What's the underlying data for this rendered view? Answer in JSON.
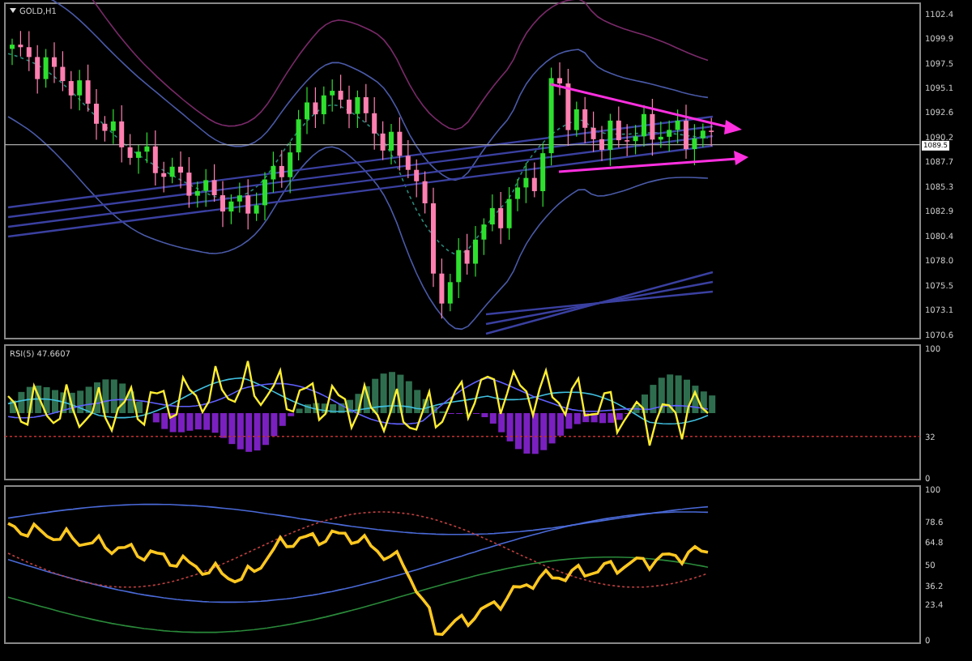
{
  "main_chart": {
    "symbol": "GOLD,H1",
    "price_axis": [
      "1102.4",
      "1099.9",
      "1097.5",
      "1095.1",
      "1092.6",
      "1090.2",
      "1087.7",
      "1085.3",
      "1082.9",
      "1080.4",
      "1078.0",
      "1075.5",
      "1073.1",
      "1070.6"
    ],
    "current_price": "1089.5"
  },
  "rsi_panel": {
    "label": "RSI(5) 47.6607",
    "axis": [
      "100",
      "32",
      "0"
    ]
  },
  "oscillator_panel": {
    "axis": [
      "100",
      "78.6",
      "64.8",
      "50",
      "36.2",
      "23.4",
      "0"
    ]
  }
}
